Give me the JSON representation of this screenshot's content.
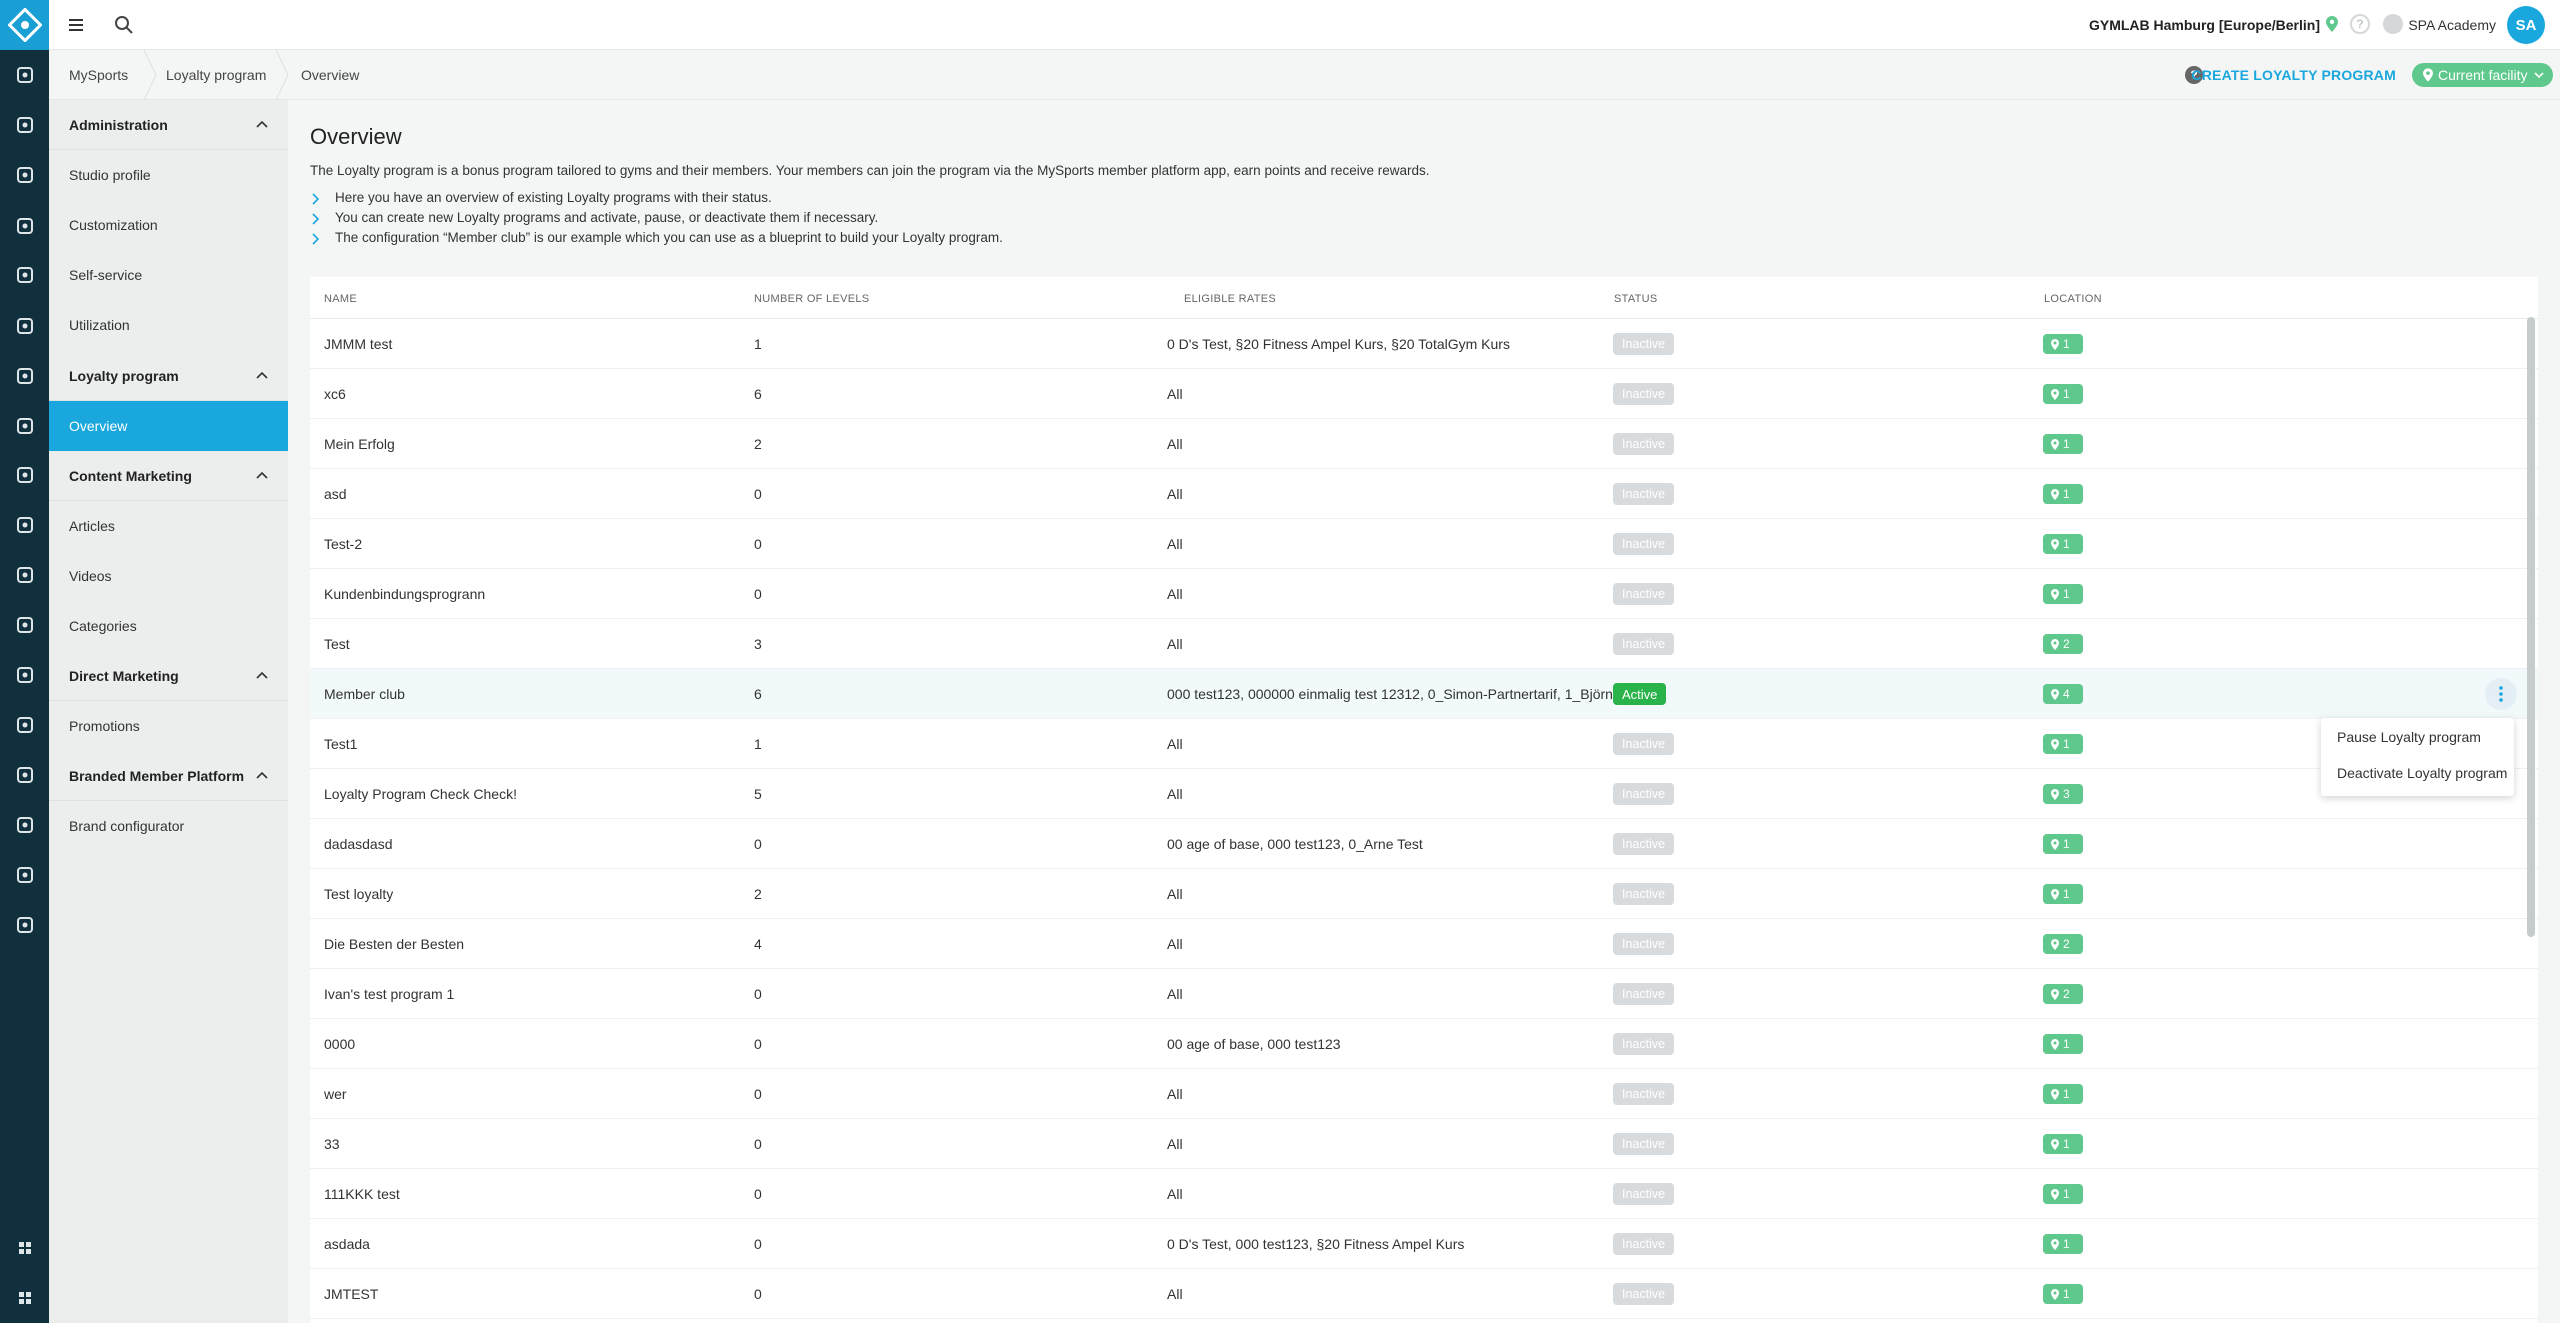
{
  "topbar": {
    "facility": "GYMLAB Hamburg [Europe/Berlin]",
    "user_name": "SPA Academy",
    "avatar_initials": "SA"
  },
  "breadcrumb": [
    "MySports",
    "Loyalty program",
    "Overview"
  ],
  "actions": {
    "create": "CREATE LOYALTY PROGRAM",
    "facility_filter": "Current facility"
  },
  "sidebar": {
    "sections": [
      {
        "label": "Administration",
        "items": [
          "Studio profile",
          "Customization",
          "Self-service",
          "Utilization"
        ]
      },
      {
        "label": "Loyalty program",
        "items": [
          "Overview"
        ]
      },
      {
        "label": "Content Marketing",
        "items": [
          "Articles",
          "Videos",
          "Categories"
        ]
      },
      {
        "label": "Direct Marketing",
        "items": [
          "Promotions"
        ]
      },
      {
        "label": "Branded Member Platform",
        "items": [
          "Brand configurator"
        ]
      }
    ],
    "active_item": "Overview"
  },
  "page": {
    "title": "Overview",
    "intro": "The Loyalty program is a bonus program tailored to gyms and their members. Your members can join the program via the MySports member platform app, earn points and receive rewards.",
    "bullets": [
      "Here you have an overview of existing Loyalty programs with their status.",
      "You can create new Loyalty programs and activate, pause, or deactivate them if necessary.",
      "The configuration “Member club” is our example which you can use as a blueprint to build your Loyalty program."
    ]
  },
  "table": {
    "headers": [
      "NAME",
      "NUMBER OF LEVELS",
      "ELIGIBLE RATES",
      "STATUS",
      "LOCATION"
    ],
    "rows": [
      {
        "name": "JMMM test",
        "levels": "1",
        "rates": "0 D's Test, §20 Fitness Ampel Kurs, §20 TotalGym Kurs",
        "status": "Inactive",
        "location": "1"
      },
      {
        "name": "xc6",
        "levels": "6",
        "rates": "All",
        "status": "Inactive",
        "location": "1"
      },
      {
        "name": "Mein Erfolg",
        "levels": "2",
        "rates": "All",
        "status": "Inactive",
        "location": "1"
      },
      {
        "name": "asd",
        "levels": "0",
        "rates": "All",
        "status": "Inactive",
        "location": "1"
      },
      {
        "name": "Test-2",
        "levels": "0",
        "rates": "All",
        "status": "Inactive",
        "location": "1"
      },
      {
        "name": "Kundenbindungsprogrann",
        "levels": "0",
        "rates": "All",
        "status": "Inactive",
        "location": "1"
      },
      {
        "name": "Test",
        "levels": "3",
        "rates": "All",
        "status": "Inactive",
        "location": "2"
      },
      {
        "name": "Member club",
        "levels": "6",
        "rates": "000 test123, 000000 einmalig test 12312, 0_Simon-Partnertarif, 1_Björn…",
        "status": "Active",
        "location": "4"
      },
      {
        "name": "Test1",
        "levels": "1",
        "rates": "All",
        "status": "Inactive",
        "location": "1"
      },
      {
        "name": "Loyalty Program Check Check!",
        "levels": "5",
        "rates": "All",
        "status": "Inactive",
        "location": "3"
      },
      {
        "name": "dadasdasd",
        "levels": "0",
        "rates": "00 age of base, 000 test123, 0_Arne Test",
        "status": "Inactive",
        "location": "1"
      },
      {
        "name": "Test loyalty",
        "levels": "2",
        "rates": "All",
        "status": "Inactive",
        "location": "1"
      },
      {
        "name": "Die Besten der Besten",
        "levels": "4",
        "rates": "All",
        "status": "Inactive",
        "location": "2"
      },
      {
        "name": "Ivan's test program 1",
        "levels": "0",
        "rates": "All",
        "status": "Inactive",
        "location": "2"
      },
      {
        "name": "0000",
        "levels": "0",
        "rates": "00 age of base, 000 test123",
        "status": "Inactive",
        "location": "1"
      },
      {
        "name": "wer",
        "levels": "0",
        "rates": "All",
        "status": "Inactive",
        "location": "1"
      },
      {
        "name": "33",
        "levels": "0",
        "rates": "All",
        "status": "Inactive",
        "location": "1"
      },
      {
        "name": "111KKK test",
        "levels": "0",
        "rates": "All",
        "status": "Inactive",
        "location": "1"
      },
      {
        "name": "asdada",
        "levels": "0",
        "rates": "0 D's Test, 000 test123, §20 Fitness Ampel Kurs",
        "status": "Inactive",
        "location": "1"
      },
      {
        "name": "JMTEST",
        "levels": "0",
        "rates": "All",
        "status": "Inactive",
        "location": "1"
      }
    ]
  },
  "context_menu": {
    "items": [
      "Pause Loyalty program",
      "Deactivate Loyalty program"
    ]
  },
  "colors": {
    "accent": "#1aa7dd",
    "rail": "#11303e",
    "active_status": "#2ab34a",
    "location_badge": "#5fc88c"
  }
}
